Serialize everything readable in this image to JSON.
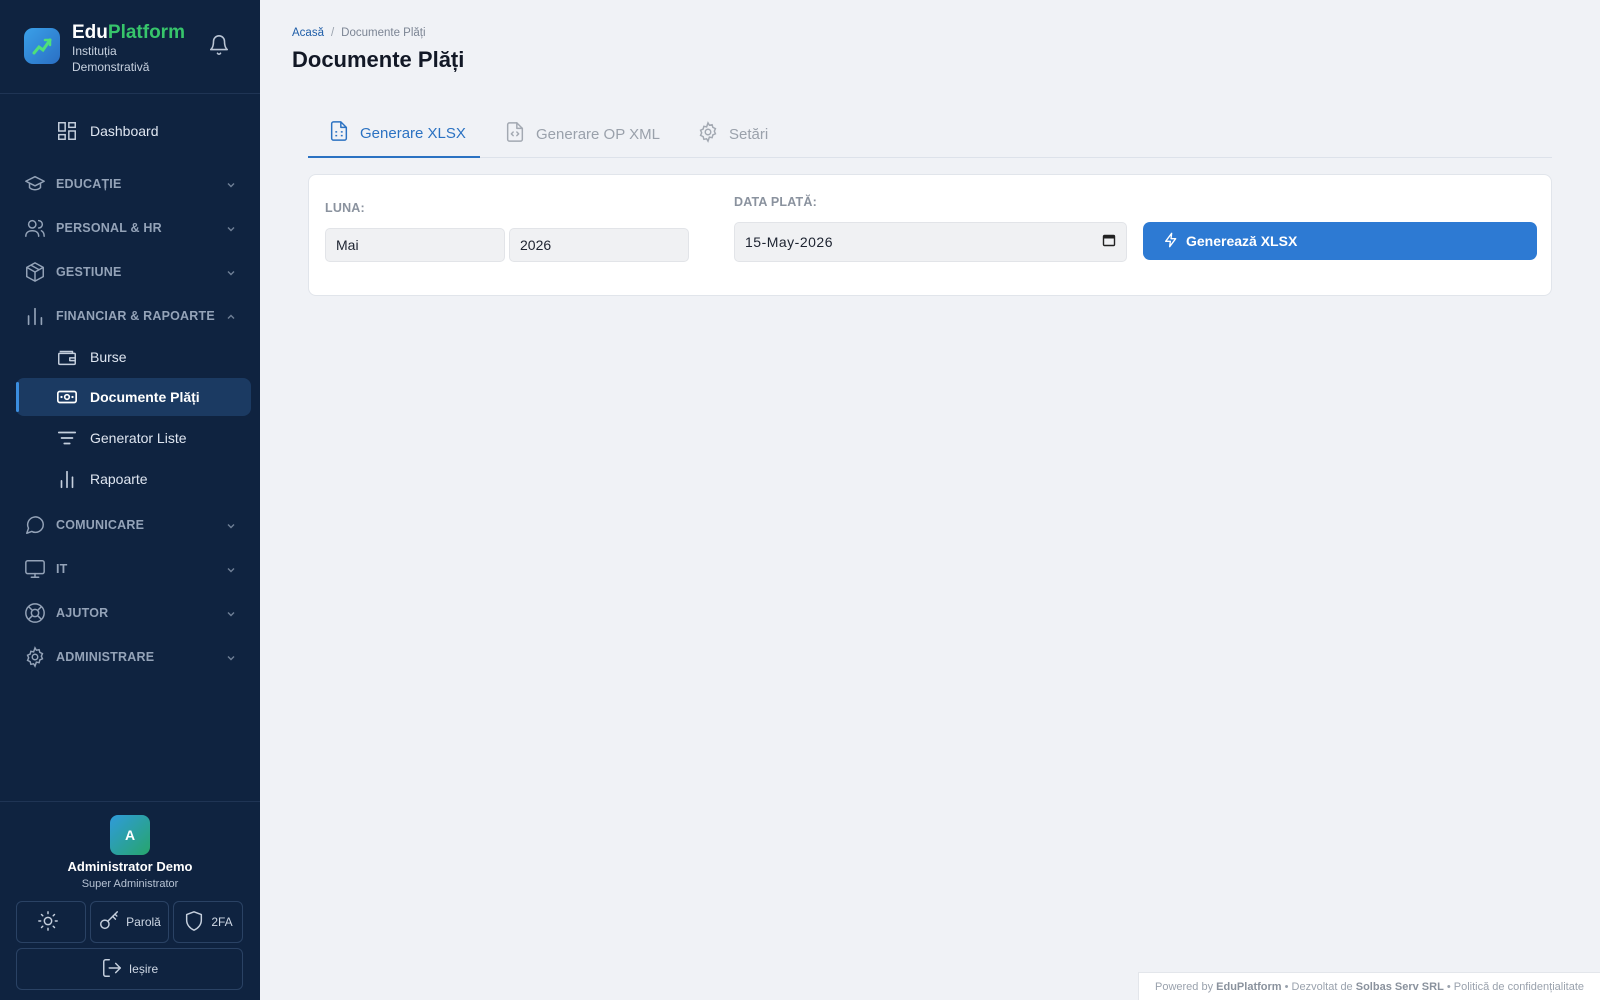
{
  "brand": {
    "name_part1": "Edu",
    "name_part2": "Platform",
    "institution": "Instituția Demonstrativă"
  },
  "nav": {
    "dashboard": "Dashboard",
    "groups": {
      "educatie": "EDUCAȚIE",
      "personal": "PERSONAL & HR",
      "gestiune": "GESTIUNE",
      "financiar": "FINANCIAR & RAPOARTE",
      "comunicare": "COMUNICARE",
      "it": "IT",
      "ajutor": "AJUTOR",
      "administrare": "ADMINISTRARE"
    },
    "financiar_items": {
      "burse": "Burse",
      "documente": "Documente Plăți",
      "generator": "Generator Liste",
      "rapoarte": "Rapoarte"
    }
  },
  "user": {
    "initial": "A",
    "name": "Administrator Demo",
    "role": "Super Administrator",
    "password_label": "Parolă",
    "twofa_label": "2FA",
    "logout_label": "Ieșire"
  },
  "breadcrumb": {
    "home": "Acasă",
    "separator": "/",
    "current": "Documente Plăți"
  },
  "page": {
    "title": "Documente Plăți"
  },
  "tabs": {
    "xlsx": "Generare XLSX",
    "opxml": "Generare OP XML",
    "setari": "Setări"
  },
  "form": {
    "luna_label": "LUNA:",
    "month_value": "Mai",
    "year_value": "2026",
    "data_plata_label": "DATA PLATĂ:",
    "date_value": "15-May-2026",
    "generate_label": "Generează XLSX"
  },
  "footer": {
    "powered": "Powered by",
    "brand": "EduPlatform",
    "dev_prefix": "• Dezvoltat de",
    "developer": "Solbas Serv SRL",
    "privacy": "• Politică de confidențialitate"
  },
  "colors": {
    "sidebar_bg": "#0f2340",
    "accent": "#2d7ad3",
    "brand_green": "#37c56b",
    "page_bg": "#f0f2f6"
  }
}
